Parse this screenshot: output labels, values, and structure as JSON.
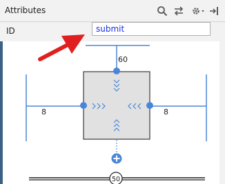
{
  "panel": {
    "title": "Attributes",
    "toolbar": {
      "icons": [
        "search-icon",
        "swap-icon",
        "gear-icon",
        "pin-icon"
      ]
    }
  },
  "id_row": {
    "label": "ID",
    "value": "submit"
  },
  "constraints": {
    "top_margin": "60",
    "left_margin": "8",
    "right_margin": "8",
    "bias": "50"
  },
  "colors": {
    "accent": "#4a86d8",
    "annotation_arrow": "#e02020",
    "input_text": "#1d2ee6"
  }
}
